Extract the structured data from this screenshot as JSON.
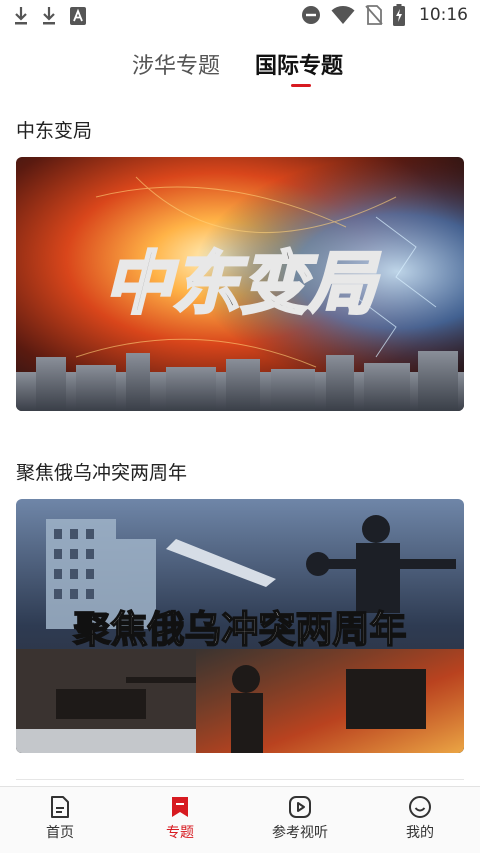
{
  "status_bar": {
    "time": "10:16",
    "icons": [
      "download-icon",
      "download-icon",
      "font-icon",
      "dnd-icon",
      "wifi-icon",
      "no-sim-icon",
      "battery-charging-icon"
    ]
  },
  "tabs": [
    {
      "label": "涉华专题",
      "active": false
    },
    {
      "label": "国际专题",
      "active": true
    }
  ],
  "sections": [
    {
      "title": "中东变局",
      "banner_text": "中东变局"
    },
    {
      "title": "聚焦俄乌冲突两周年",
      "banner_text": "聚焦俄乌冲突两周年"
    }
  ],
  "bottom_nav": [
    {
      "label": "首页",
      "icon": "document-icon",
      "active": false
    },
    {
      "label": "专题",
      "icon": "bookmark-icon",
      "active": true
    },
    {
      "label": "参考视听",
      "icon": "play-icon",
      "active": false
    },
    {
      "label": "我的",
      "icon": "smile-icon",
      "active": false
    }
  ],
  "colors": {
    "accent": "#d71a20"
  }
}
